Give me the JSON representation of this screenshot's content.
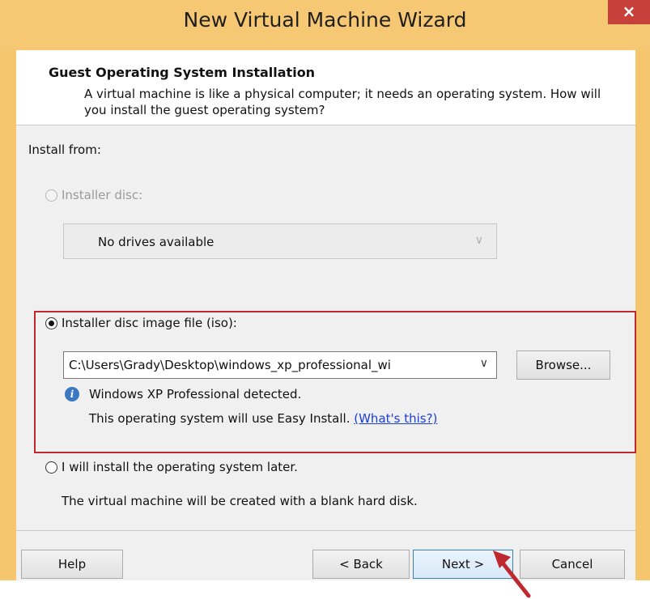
{
  "window": {
    "title": "New Virtual Machine Wizard",
    "close_glyph": "×"
  },
  "header": {
    "title": "Guest Operating System Installation",
    "description": "A virtual machine is like a physical computer; it needs an operating system. How will you install the guest operating system?"
  },
  "install_from_label": "Install from:",
  "installer_disc": {
    "label": "Installer disc:",
    "selected": false,
    "enabled": false,
    "drive_value": "No drives available"
  },
  "iso_option": {
    "label": "Installer disc image file (iso):",
    "selected": true,
    "path_value": "C:\\Users\\Grady\\Desktop\\windows_xp_professional_wi",
    "browse_label": "Browse...",
    "detected_text": "Windows XP Professional detected.",
    "easy_install_text": "This operating system will use Easy Install.",
    "whats_this_link": "(What's this?)"
  },
  "later_option": {
    "label": "I will install the operating system later.",
    "selected": false,
    "description": "The virtual machine will be created with a blank hard disk."
  },
  "footer": {
    "help_label": "Help",
    "back_label": "< Back",
    "next_label": "Next >",
    "cancel_label": "Cancel"
  },
  "colors": {
    "frame": "#f6c66e",
    "highlight_border": "#c0282f",
    "close_button": "#c7403a",
    "link": "#1a3ddc"
  }
}
